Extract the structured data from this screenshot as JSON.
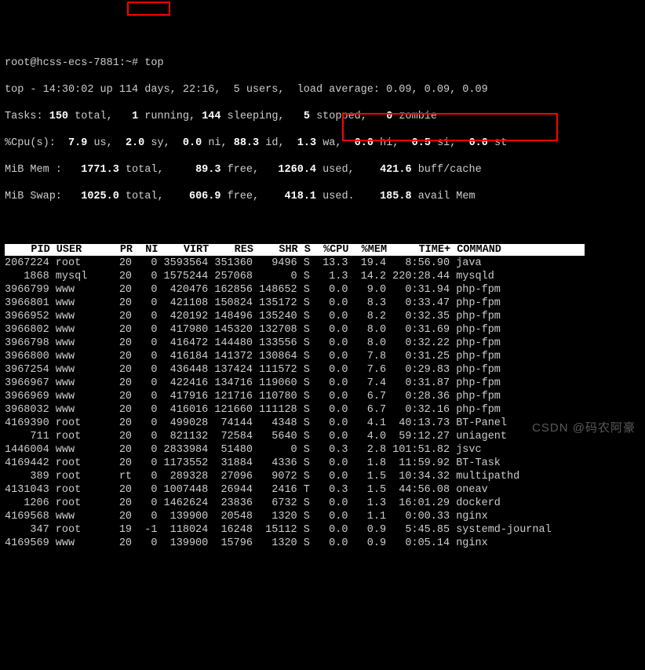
{
  "prompt": "root@hcss-ecs-7881:~#",
  "command": "top",
  "summary": {
    "line1_prefix": "top - 14:30:02 up 114 days, 22:16,  5 users,  load average: 0.09, 0.09, 0.09",
    "tasks_label": "Tasks:",
    "tasks_total": "150",
    "tasks_total_lbl": "total,",
    "tasks_running": "1",
    "tasks_running_lbl": "running,",
    "tasks_sleeping": "144",
    "tasks_sleeping_lbl": "sleeping,",
    "tasks_stopped": "5",
    "tasks_stopped_lbl": "stopped,",
    "tasks_zombie": "0",
    "tasks_zombie_lbl": "zombie",
    "cpu_label": "%Cpu(s):",
    "cpu_us": "7.9",
    "cpu_us_lbl": "us,",
    "cpu_sy": "2.0",
    "cpu_sy_lbl": "sy,",
    "cpu_ni": "0.0",
    "cpu_ni_lbl": "ni,",
    "cpu_id": "88.3",
    "cpu_id_lbl": "id,",
    "cpu_wa": "1.3",
    "cpu_wa_lbl": "wa,",
    "cpu_hi": "0.0",
    "cpu_hi_lbl": "hi,",
    "cpu_si": "0.5",
    "cpu_si_lbl": "si,",
    "cpu_st": "0.0",
    "cpu_st_lbl": "st",
    "mem_label": "MiB Mem :",
    "mem_total": "1771.3",
    "mem_total_lbl": "total,",
    "mem_free": "89.3",
    "mem_free_lbl": "free,",
    "mem_used": "1260.4",
    "mem_used_lbl": "used,",
    "mem_buff": "421.6",
    "mem_buff_lbl": "buff/cache",
    "swap_label": "MiB Swap:",
    "swap_total": "1025.0",
    "swap_total_lbl": "total,",
    "swap_free": "606.9",
    "swap_free_lbl": "free,",
    "swap_used": "418.1",
    "swap_used_lbl": "used.",
    "swap_avail": "185.8",
    "swap_avail_lbl": "avail Mem"
  },
  "columns": [
    "PID",
    "USER",
    "PR",
    "NI",
    "VIRT",
    "RES",
    "SHR",
    "S",
    "%CPU",
    "%MEM",
    "TIME+",
    "COMMAND"
  ],
  "rows": [
    {
      "pid": "2067224",
      "user": "root",
      "pr": "20",
      "ni": "0",
      "virt": "3593564",
      "res": "351360",
      "shr": "9496",
      "s": "S",
      "cpu": "13.3",
      "mem": "19.4",
      "time": "8:56.90",
      "cmd": "java"
    },
    {
      "pid": "1868",
      "user": "mysql",
      "pr": "20",
      "ni": "0",
      "virt": "1575244",
      "res": "257068",
      "shr": "0",
      "s": "S",
      "cpu": "1.3",
      "mem": "14.2",
      "time": "220:28.44",
      "cmd": "mysqld"
    },
    {
      "pid": "3966799",
      "user": "www",
      "pr": "20",
      "ni": "0",
      "virt": "420476",
      "res": "162856",
      "shr": "148652",
      "s": "S",
      "cpu": "0.0",
      "mem": "9.0",
      "time": "0:31.94",
      "cmd": "php-fpm"
    },
    {
      "pid": "3966801",
      "user": "www",
      "pr": "20",
      "ni": "0",
      "virt": "421108",
      "res": "150824",
      "shr": "135172",
      "s": "S",
      "cpu": "0.0",
      "mem": "8.3",
      "time": "0:33.47",
      "cmd": "php-fpm"
    },
    {
      "pid": "3966952",
      "user": "www",
      "pr": "20",
      "ni": "0",
      "virt": "420192",
      "res": "148496",
      "shr": "135240",
      "s": "S",
      "cpu": "0.0",
      "mem": "8.2",
      "time": "0:32.35",
      "cmd": "php-fpm"
    },
    {
      "pid": "3966802",
      "user": "www",
      "pr": "20",
      "ni": "0",
      "virt": "417980",
      "res": "145320",
      "shr": "132708",
      "s": "S",
      "cpu": "0.0",
      "mem": "8.0",
      "time": "0:31.69",
      "cmd": "php-fpm"
    },
    {
      "pid": "3966798",
      "user": "www",
      "pr": "20",
      "ni": "0",
      "virt": "416472",
      "res": "144480",
      "shr": "133556",
      "s": "S",
      "cpu": "0.0",
      "mem": "8.0",
      "time": "0:32.22",
      "cmd": "php-fpm"
    },
    {
      "pid": "3966800",
      "user": "www",
      "pr": "20",
      "ni": "0",
      "virt": "416184",
      "res": "141372",
      "shr": "130864",
      "s": "S",
      "cpu": "0.0",
      "mem": "7.8",
      "time": "0:31.25",
      "cmd": "php-fpm"
    },
    {
      "pid": "3967254",
      "user": "www",
      "pr": "20",
      "ni": "0",
      "virt": "436448",
      "res": "137424",
      "shr": "111572",
      "s": "S",
      "cpu": "0.0",
      "mem": "7.6",
      "time": "0:29.83",
      "cmd": "php-fpm"
    },
    {
      "pid": "3966967",
      "user": "www",
      "pr": "20",
      "ni": "0",
      "virt": "422416",
      "res": "134716",
      "shr": "119060",
      "s": "S",
      "cpu": "0.0",
      "mem": "7.4",
      "time": "0:31.87",
      "cmd": "php-fpm"
    },
    {
      "pid": "3966969",
      "user": "www",
      "pr": "20",
      "ni": "0",
      "virt": "417916",
      "res": "121716",
      "shr": "110780",
      "s": "S",
      "cpu": "0.0",
      "mem": "6.7",
      "time": "0:28.36",
      "cmd": "php-fpm"
    },
    {
      "pid": "3968032",
      "user": "www",
      "pr": "20",
      "ni": "0",
      "virt": "416016",
      "res": "121660",
      "shr": "111128",
      "s": "S",
      "cpu": "0.0",
      "mem": "6.7",
      "time": "0:32.16",
      "cmd": "php-fpm"
    },
    {
      "pid": "4169390",
      "user": "root",
      "pr": "20",
      "ni": "0",
      "virt": "499028",
      "res": "74144",
      "shr": "4348",
      "s": "S",
      "cpu": "0.0",
      "mem": "4.1",
      "time": "40:13.73",
      "cmd": "BT-Panel"
    },
    {
      "pid": "711",
      "user": "root",
      "pr": "20",
      "ni": "0",
      "virt": "821132",
      "res": "72584",
      "shr": "5640",
      "s": "S",
      "cpu": "0.0",
      "mem": "4.0",
      "time": "59:12.27",
      "cmd": "uniagent"
    },
    {
      "pid": "1446004",
      "user": "www",
      "pr": "20",
      "ni": "0",
      "virt": "2833984",
      "res": "51480",
      "shr": "0",
      "s": "S",
      "cpu": "0.3",
      "mem": "2.8",
      "time": "101:51.82",
      "cmd": "jsvc"
    },
    {
      "pid": "4169442",
      "user": "root",
      "pr": "20",
      "ni": "0",
      "virt": "1173552",
      "res": "31884",
      "shr": "4336",
      "s": "S",
      "cpu": "0.0",
      "mem": "1.8",
      "time": "11:59.92",
      "cmd": "BT-Task"
    },
    {
      "pid": "389",
      "user": "root",
      "pr": "rt",
      "ni": "0",
      "virt": "289328",
      "res": "27096",
      "shr": "9072",
      "s": "S",
      "cpu": "0.0",
      "mem": "1.5",
      "time": "10:34.32",
      "cmd": "multipathd"
    },
    {
      "pid": "4131043",
      "user": "root",
      "pr": "20",
      "ni": "0",
      "virt": "1007448",
      "res": "26944",
      "shr": "2416",
      "s": "T",
      "cpu": "0.3",
      "mem": "1.5",
      "time": "44:56.08",
      "cmd": "oneav"
    },
    {
      "pid": "1206",
      "user": "root",
      "pr": "20",
      "ni": "0",
      "virt": "1462624",
      "res": "23836",
      "shr": "6732",
      "s": "S",
      "cpu": "0.0",
      "mem": "1.3",
      "time": "16:01.29",
      "cmd": "dockerd"
    },
    {
      "pid": "4169568",
      "user": "www",
      "pr": "20",
      "ni": "0",
      "virt": "139900",
      "res": "20548",
      "shr": "1320",
      "s": "S",
      "cpu": "0.0",
      "mem": "1.1",
      "time": "0:00.33",
      "cmd": "nginx"
    },
    {
      "pid": "347",
      "user": "root",
      "pr": "19",
      "ni": "-1",
      "virt": "118024",
      "res": "16248",
      "shr": "15112",
      "s": "S",
      "cpu": "0.0",
      "mem": "0.9",
      "time": "5:45.85",
      "cmd": "systemd-journal"
    },
    {
      "pid": "4169569",
      "user": "www",
      "pr": "20",
      "ni": "0",
      "virt": "139900",
      "res": "15796",
      "shr": "1320",
      "s": "S",
      "cpu": "0.0",
      "mem": "0.9",
      "time": "0:05.14",
      "cmd": "nginx"
    }
  ],
  "watermark": "CSDN @码农阿豪",
  "highlight_cmd": "top",
  "highlight_row_idx": 0
}
